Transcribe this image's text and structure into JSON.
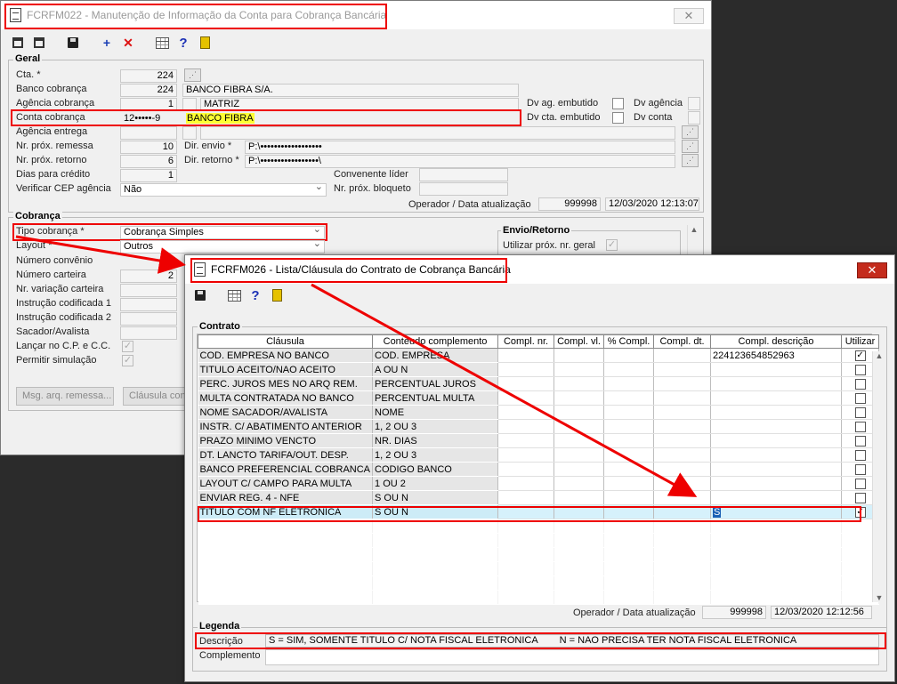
{
  "win1": {
    "title": "FCRFM022 - Manutenção de Informação da Conta para Cobrança Bancária",
    "close": "✕",
    "geral": {
      "section": "Geral",
      "cta_label": "Cta. *",
      "cta_value": "224",
      "banco_label": "Banco cobrança",
      "banco_num": "224",
      "banco_nome": "BANCO FIBRA S/A.",
      "agencia_label": "Agência cobrança",
      "agencia_num": "1",
      "agencia_nome": "MATRIZ",
      "conta_label": "Conta cobrança",
      "conta_num": "12•••••-9",
      "conta_nome": "BANCO FIBRA",
      "agencia_entrega_label": "Agência entrega",
      "remessa_label": "Nr. próx. remessa",
      "remessa_value": "10",
      "retorno_label": "Nr. próx. retorno",
      "retorno_value": "6",
      "dias_label": "Dias para crédito",
      "dias_value": "1",
      "cep_label": "Verificar CEP agência",
      "cep_value": "Não",
      "dv_ag_emb_label": "Dv ag. embutido",
      "dv_agencia_label": "Dv agência",
      "dv_cta_emb_label": "Dv cta. embutido",
      "dv_conta_label": "Dv conta",
      "dir_envio_label": "Dir. envio *",
      "dir_envio_value": "P:\\••••••••••••••••••",
      "dir_retorno_label": "Dir. retorno *",
      "dir_retorno_value": "P:\\•••••••••••••••••\\",
      "conv_label": "Convenente líder",
      "bloq_label": "Nr. próx. bloqueto",
      "operador_label": "Operador / Data atualização",
      "operador_value": "999998",
      "data_value": "12/03/2020 12:13:07"
    },
    "cobranca": {
      "section": "Cobrança",
      "tipo_label": "Tipo cobrança *",
      "tipo_value": "Cobrança Simples",
      "layout_label": "Layout *",
      "layout_value": "Outros",
      "convenio_label": "Número convênio",
      "carteira_label": "Número carteira",
      "carteira_value": "2",
      "variacao_label": "Nr. variação carteira",
      "instr1_label": "Instrução codificada 1",
      "instr2_label": "Instrução codificada 2",
      "sacador_label": "Sacador/Avalista",
      "lancar_label": "Lançar no C.P. e C.C.",
      "simulacao_label": "Permitir simulação",
      "envio_section": "Envio/Retorno",
      "utilizar_label": "Utilizar próx. nr. geral",
      "msg_button": "Msg. arq. remessa...",
      "clausula_button": "Cláusula cont"
    }
  },
  "win2": {
    "title": "FCRFM026 - Lista/Cláusula do Contrato de Cobrança Bancária",
    "close": "✕",
    "contrato_section": "Contrato",
    "columns": [
      "Cláusula",
      "Conteudo complemento",
      "Compl. nr.",
      "Compl. vl.",
      "% Compl.",
      "Compl. dt.",
      "Compl. descrição",
      "Utilizar"
    ],
    "rows": [
      {
        "clausula": "COD. EMPRESA NO BANCO",
        "conteudo": "COD. EMPRESA",
        "descricao": "224123654852963",
        "utilizar": "✓"
      },
      {
        "clausula": "TITULO ACEITO/NAO ACEITO",
        "conteudo": "A OU N",
        "descricao": "",
        "utilizar": ""
      },
      {
        "clausula": "PERC. JUROS MES NO ARQ REM.",
        "conteudo": "PERCENTUAL JUROS",
        "descricao": "",
        "utilizar": ""
      },
      {
        "clausula": "MULTA CONTRATADA NO BANCO",
        "conteudo": "PERCENTUAL MULTA",
        "descricao": "",
        "utilizar": ""
      },
      {
        "clausula": "NOME SACADOR/AVALISTA",
        "conteudo": "NOME",
        "descricao": "",
        "utilizar": ""
      },
      {
        "clausula": "INSTR. C/ ABATIMENTO ANTERIOR",
        "conteudo": "1, 2 OU 3",
        "descricao": "",
        "utilizar": ""
      },
      {
        "clausula": "PRAZO MINIMO VENCTO",
        "conteudo": "NR. DIAS",
        "descricao": "",
        "utilizar": ""
      },
      {
        "clausula": "DT. LANCTO TARIFA/OUT. DESP.",
        "conteudo": "1, 2 OU 3",
        "descricao": "",
        "utilizar": ""
      },
      {
        "clausula": "BANCO PREFERENCIAL COBRANCA",
        "conteudo": "CODIGO BANCO",
        "descricao": "",
        "utilizar": ""
      },
      {
        "clausula": "LAYOUT C/ CAMPO PARA MULTA",
        "conteudo": "1 OU 2",
        "descricao": "",
        "utilizar": ""
      },
      {
        "clausula": "ENVIAR REG. 4 - NFE",
        "conteudo": "S OU N",
        "descricao": "",
        "utilizar": ""
      },
      {
        "clausula": "TITULO COM NF ELETRONICA",
        "conteudo": "S OU N",
        "descricao": "S",
        "utilizar": "✓"
      }
    ],
    "operador_label": "Operador / Data atualização",
    "operador_value": "999998",
    "data_value": "12/03/2020 12:12:56",
    "legenda_section": "Legenda",
    "descricao_label": "Descrição",
    "descricao_s": "S = SIM, SOMENTE TITULO C/  NOTA FISCAL ELETRONICA",
    "descricao_n": "N = NAO PRECISA TER NOTA FISCAL ELETRONICA",
    "complemento_label": "Complemento"
  }
}
